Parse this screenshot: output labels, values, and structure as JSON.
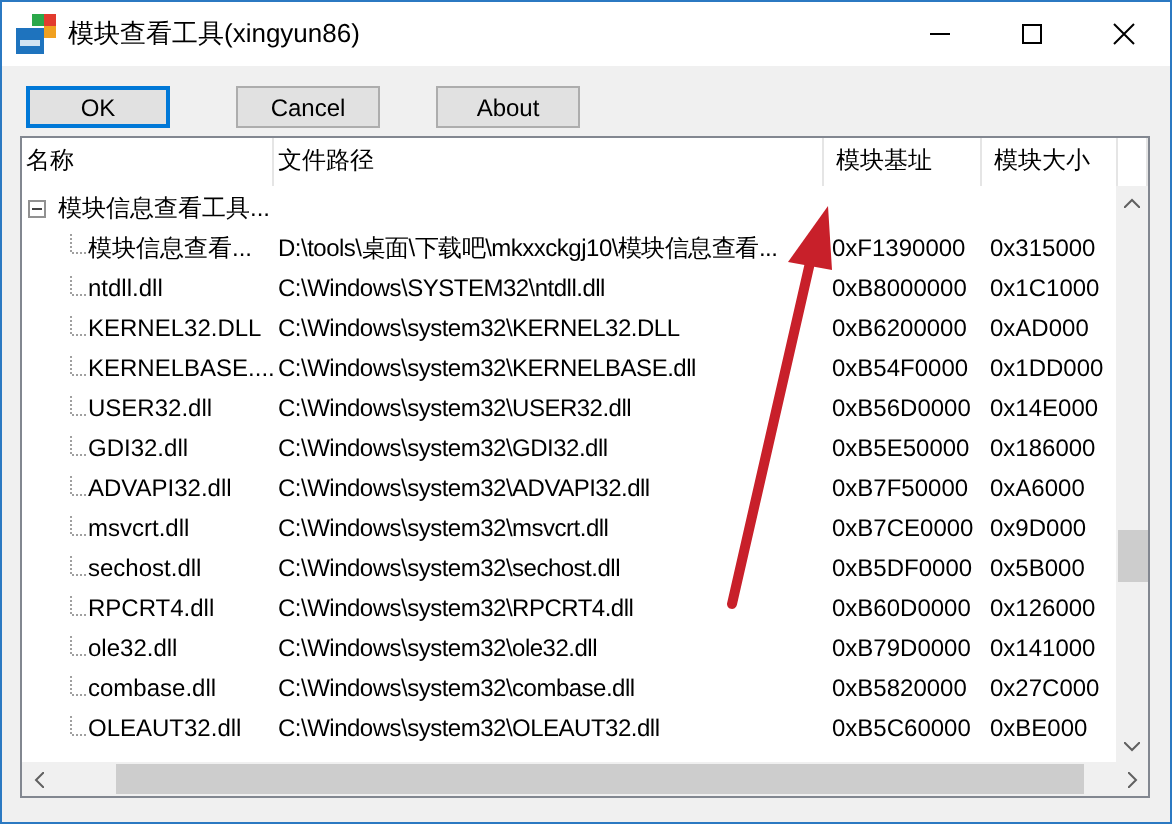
{
  "window": {
    "title": "模块查看工具(xingyun86)"
  },
  "buttons": [
    {
      "label": "OK",
      "default": true
    },
    {
      "label": "Cancel",
      "default": false
    },
    {
      "label": "About",
      "default": false
    }
  ],
  "table": {
    "columns": [
      "名称",
      "文件路径",
      "模块基址",
      "模块大小"
    ],
    "rows": [
      {
        "name": "模块信息查看工具...",
        "expanded": true,
        "children": [
          {
            "name": "模块信息查看...",
            "path": "D:\\tools\\桌面\\下载吧\\mkxxckgj10\\模块信息查看...",
            "base": "0xF1390000",
            "size": "0x315000"
          },
          {
            "name": "ntdll.dll",
            "path": "C:\\Windows\\SYSTEM32\\ntdll.dll",
            "base": "0xB8000000",
            "size": "0x1C1000"
          },
          {
            "name": "KERNEL32.DLL",
            "path": "C:\\Windows\\system32\\KERNEL32.DLL",
            "base": "0xB6200000",
            "size": "0xAD000"
          },
          {
            "name": "KERNELBASE....",
            "path": "C:\\Windows\\system32\\KERNELBASE.dll",
            "base": "0xB54F0000",
            "size": "0x1DD000"
          },
          {
            "name": "USER32.dll",
            "path": "C:\\Windows\\system32\\USER32.dll",
            "base": "0xB56D0000",
            "size": "0x14E000"
          },
          {
            "name": "GDI32.dll",
            "path": "C:\\Windows\\system32\\GDI32.dll",
            "base": "0xB5E50000",
            "size": "0x186000"
          },
          {
            "name": "ADVAPI32.dll",
            "path": "C:\\Windows\\system32\\ADVAPI32.dll",
            "base": "0xB7F50000",
            "size": "0xA6000"
          },
          {
            "name": "msvcrt.dll",
            "path": "C:\\Windows\\system32\\msvcrt.dll",
            "base": "0xB7CE0000",
            "size": "0x9D000"
          },
          {
            "name": "sechost.dll",
            "path": "C:\\Windows\\system32\\sechost.dll",
            "base": "0xB5DF0000",
            "size": "0x5B000"
          },
          {
            "name": "RPCRT4.dll",
            "path": "C:\\Windows\\system32\\RPCRT4.dll",
            "base": "0xB60D0000",
            "size": "0x126000"
          },
          {
            "name": "ole32.dll",
            "path": "C:\\Windows\\system32\\ole32.dll",
            "base": "0xB79D0000",
            "size": "0x141000"
          },
          {
            "name": "combase.dll",
            "path": "C:\\Windows\\system32\\combase.dll",
            "base": "0xB5820000",
            "size": "0x27C000"
          },
          {
            "name": "OLEAUT32.dll",
            "path": "C:\\Windows\\system32\\OLEAUT32.dll",
            "base": "0xB5C60000",
            "size": "0xBE000"
          }
        ]
      }
    ]
  },
  "annotation": {
    "kind": "arrow"
  }
}
